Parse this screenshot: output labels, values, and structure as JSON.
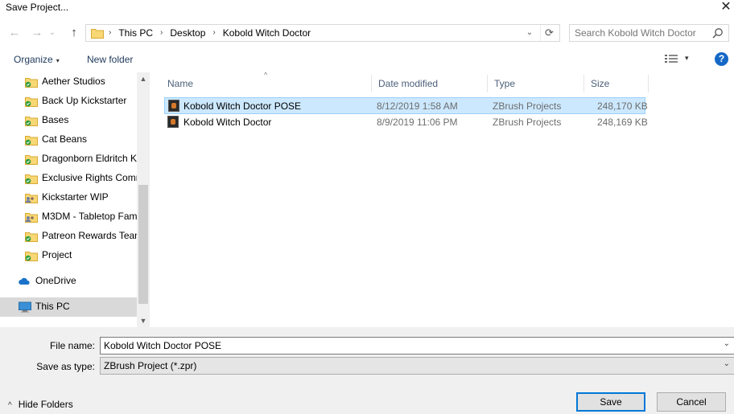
{
  "window": {
    "title": "Save Project...",
    "close_glyph": "✕"
  },
  "nav": {
    "back_glyph": "←",
    "forward_glyph": "→",
    "recent_glyph": "⌄",
    "up_glyph": "↑",
    "breadcrumbs": [
      "This PC",
      "Desktop",
      "Kobold Witch Doctor"
    ],
    "crumb_sep": "›",
    "dropdown_glyph": "⌄",
    "refresh_glyph": "⟳",
    "search_placeholder": "Search Kobold Witch Doctor"
  },
  "toolbar": {
    "organize_label": "Organize",
    "organize_arrow": "▾",
    "new_folder_label": "New folder",
    "view_arrow": "▾",
    "help_glyph": "?"
  },
  "sidebar": {
    "scroll_up": "▲",
    "scroll_down": "▼",
    "items": [
      {
        "label": "Aether Studios",
        "icon": "folder-synced-icon"
      },
      {
        "label": "Back Up Kickstarter",
        "icon": "folder-synced-icon"
      },
      {
        "label": "Bases",
        "icon": "folder-synced-icon"
      },
      {
        "label": "Cat Beans",
        "icon": "folder-synced-icon"
      },
      {
        "label": "Dragonborn Eldritch K",
        "icon": "folder-synced-icon"
      },
      {
        "label": "Exclusive Rights Comr",
        "icon": "folder-synced-icon"
      },
      {
        "label": "Kickstarter WIP",
        "icon": "folder-shared-icon"
      },
      {
        "label": "M3DM - Tabletop Fam",
        "icon": "folder-shared-icon"
      },
      {
        "label": "Patreon Rewards Team",
        "icon": "folder-synced-icon"
      },
      {
        "label": "Project",
        "icon": "folder-synced-icon"
      }
    ],
    "onedrive_label": "OneDrive",
    "thispc_label": "This PC"
  },
  "files": {
    "sort_glyph": "^",
    "columns": [
      "Name",
      "Date modified",
      "Type",
      "Size"
    ],
    "rows": [
      {
        "name": "Kobold Witch Doctor POSE",
        "date": "8/12/2019 1:58 AM",
        "type": "ZBrush Projects",
        "size": "248,170 KB",
        "selected": true
      },
      {
        "name": "Kobold Witch Doctor",
        "date": "8/9/2019 11:06 PM",
        "type": "ZBrush Projects",
        "size": "248,169 KB",
        "selected": false
      }
    ]
  },
  "form": {
    "filename_label": "File name:",
    "filename_value": "Kobold Witch Doctor POSE",
    "type_label": "Save as type:",
    "type_value": "ZBrush Project (*.zpr)",
    "dropdown_glyph": "⌄"
  },
  "footer": {
    "hide_folders_label": "Hide Folders",
    "hide_folders_glyph": "^",
    "save_label": "Save",
    "cancel_label": "Cancel"
  },
  "colors": {
    "selection_fill": "#cce8ff",
    "selection_border": "#99d1ff",
    "accent": "#0078d7",
    "help_blue": "#1568c6",
    "folder_yellow": "#f8d775",
    "sync_green": "#2e9c3c"
  }
}
